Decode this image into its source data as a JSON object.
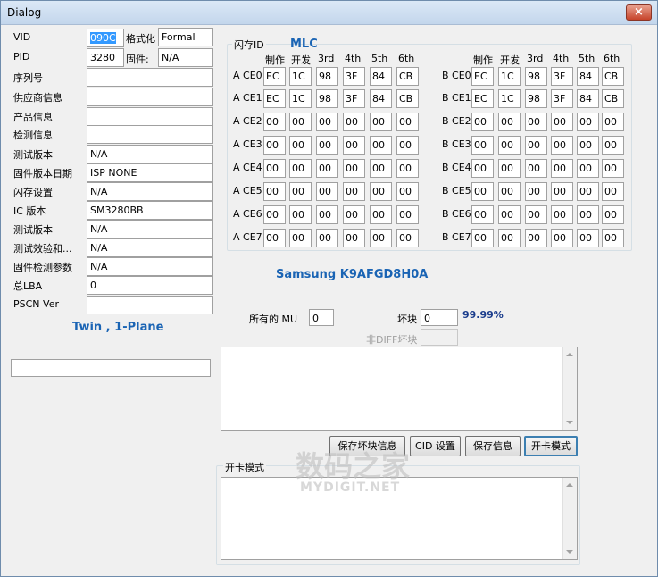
{
  "window": {
    "title": "Dialog",
    "close_glyph": "×"
  },
  "left_fields": [
    {
      "label": "VID",
      "value": "090C"
    },
    {
      "label": "PID",
      "value": "3280"
    },
    {
      "label": "序列号",
      "value": ""
    },
    {
      "label": "供应商信息",
      "value": ""
    },
    {
      "label": "产品信息",
      "value": ""
    },
    {
      "label": "检测信息",
      "value": ""
    },
    {
      "label": "测试版本",
      "value": "N/A"
    },
    {
      "label": "固件版本日期",
      "value": "ISP NONE"
    },
    {
      "label": "闪存设置",
      "value": "N/A"
    },
    {
      "label": "IC 版本",
      "value": "SM3280BB"
    },
    {
      "label": "测试版本",
      "value": "N/A"
    },
    {
      "label": "测试效验和...",
      "value": "N/A"
    },
    {
      "label": "固件检测参数",
      "value": "N/A"
    },
    {
      "label": "总LBA",
      "value": "0"
    },
    {
      "label": "PSCN Ver",
      "value": ""
    }
  ],
  "format": {
    "label": "格式化",
    "value": "Formal"
  },
  "firmware": {
    "label": "固件:",
    "value": "N/A"
  },
  "mode_text": "Twin , 1-Plane",
  "flash_group": {
    "label": "闪存ID",
    "type": "MLC",
    "headers": [
      "制作",
      "开发",
      "3rd",
      "4th",
      "5th",
      "6th"
    ],
    "a_rows": [
      {
        "name": "A CE0",
        "values": [
          "EC",
          "1C",
          "98",
          "3F",
          "84",
          "CB"
        ]
      },
      {
        "name": "A CE1",
        "values": [
          "EC",
          "1C",
          "98",
          "3F",
          "84",
          "CB"
        ]
      },
      {
        "name": "A CE2",
        "values": [
          "00",
          "00",
          "00",
          "00",
          "00",
          "00"
        ]
      },
      {
        "name": "A CE3",
        "values": [
          "00",
          "00",
          "00",
          "00",
          "00",
          "00"
        ]
      },
      {
        "name": "A CE4",
        "values": [
          "00",
          "00",
          "00",
          "00",
          "00",
          "00"
        ]
      },
      {
        "name": "A CE5",
        "values": [
          "00",
          "00",
          "00",
          "00",
          "00",
          "00"
        ]
      },
      {
        "name": "A CE6",
        "values": [
          "00",
          "00",
          "00",
          "00",
          "00",
          "00"
        ]
      },
      {
        "name": "A CE7",
        "values": [
          "00",
          "00",
          "00",
          "00",
          "00",
          "00"
        ]
      }
    ],
    "b_rows": [
      {
        "name": "B CE0",
        "values": [
          "EC",
          "1C",
          "98",
          "3F",
          "84",
          "CB"
        ]
      },
      {
        "name": "B CE1",
        "values": [
          "EC",
          "1C",
          "98",
          "3F",
          "84",
          "CB"
        ]
      },
      {
        "name": "B CE2",
        "values": [
          "00",
          "00",
          "00",
          "00",
          "00",
          "00"
        ]
      },
      {
        "name": "B CE3",
        "values": [
          "00",
          "00",
          "00",
          "00",
          "00",
          "00"
        ]
      },
      {
        "name": "B CE4",
        "values": [
          "00",
          "00",
          "00",
          "00",
          "00",
          "00"
        ]
      },
      {
        "name": "B CE5",
        "values": [
          "00",
          "00",
          "00",
          "00",
          "00",
          "00"
        ]
      },
      {
        "name": "B CE6",
        "values": [
          "00",
          "00",
          "00",
          "00",
          "00",
          "00"
        ]
      },
      {
        "name": "B CE7",
        "values": [
          "00",
          "00",
          "00",
          "00",
          "00",
          "00"
        ]
      }
    ]
  },
  "flash_model": "Samsung K9AFGD8H0A",
  "mu": {
    "label": "所有的 MU",
    "value": "0"
  },
  "bad_block": {
    "label": "坏块",
    "value": "0",
    "percent": "99.99%"
  },
  "non_diff": {
    "label": "非DIFF坏块",
    "value": ""
  },
  "buttons": {
    "save_bad_blocks": "保存坏块信息",
    "cid_settings": "CID 设置",
    "save_info": "保存信息",
    "card_mode": "开卡模式"
  },
  "card_mode_group": {
    "label": "开卡模式"
  },
  "watermark": {
    "brand": "数码之家",
    "url": "MYDIGIT.NET"
  },
  "colors": {
    "accent_blue": "#1a64b4",
    "selection": "#3399ff",
    "percent_blue": "#1a3c8c"
  }
}
